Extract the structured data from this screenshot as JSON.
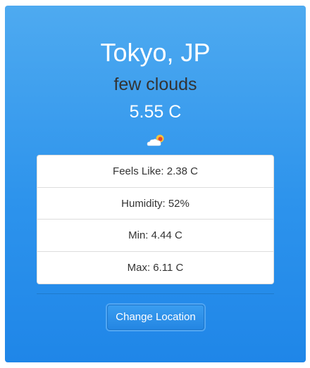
{
  "weather": {
    "location": "Tokyo, JP",
    "description": "few clouds",
    "temperature": "5.55 C",
    "icon": "few-clouds-day-icon"
  },
  "details": [
    {
      "label": "Feels Like: 2.38 C"
    },
    {
      "label": "Humidity: 52%"
    },
    {
      "label": "Min: 4.44 C"
    },
    {
      "label": "Max: 6.11 C"
    }
  ],
  "actions": {
    "change_location_label": "Change Location"
  },
  "colors": {
    "card_gradient_top": "#4eaaf0",
    "card_gradient_bottom": "#1f86e8",
    "button": "#2a8de8",
    "text_dark": "#333333"
  }
}
